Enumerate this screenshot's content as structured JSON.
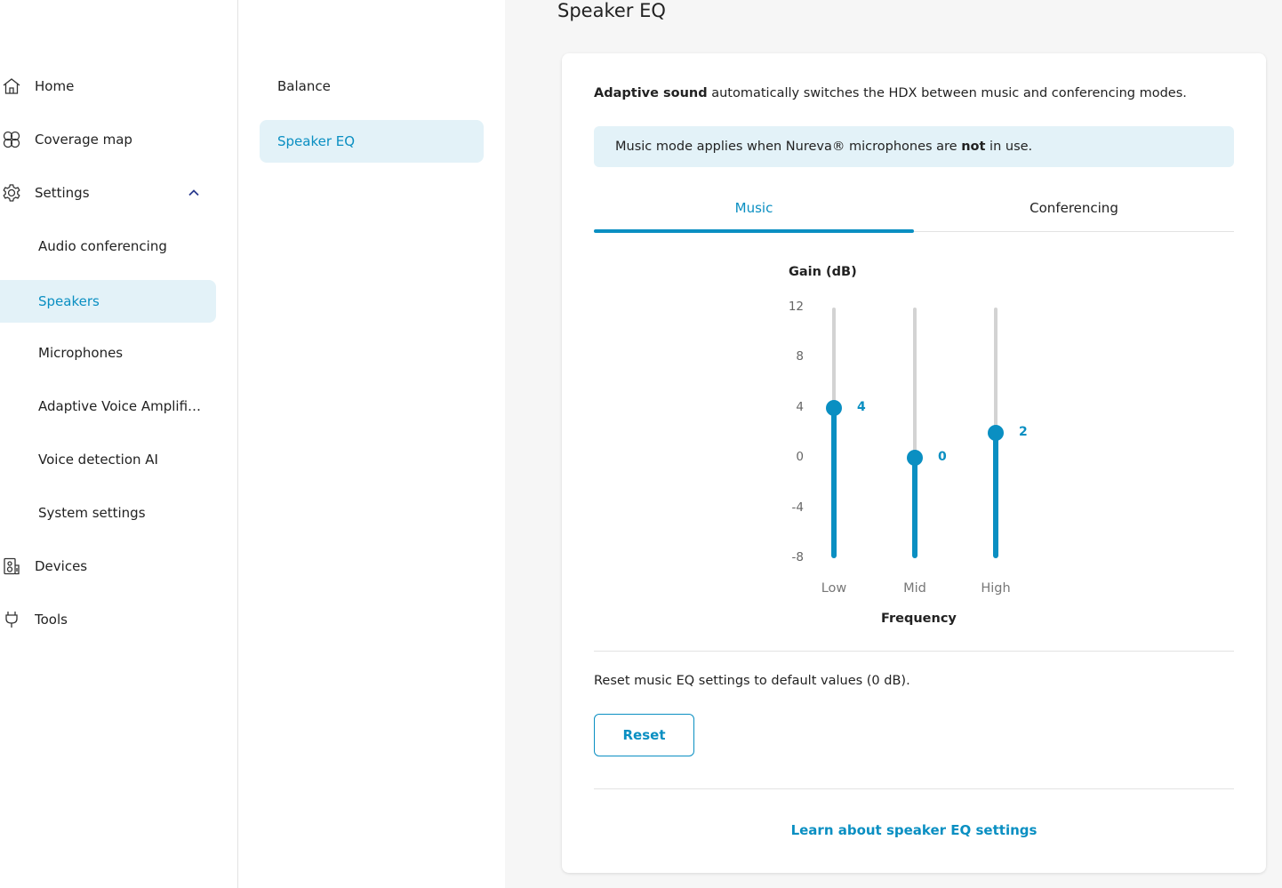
{
  "nav": {
    "home": "Home",
    "coverage_map": "Coverage map",
    "settings": "Settings",
    "sub": {
      "audio_conferencing": "Audio conferencing",
      "speakers": "Speakers",
      "microphones": "Microphones",
      "adaptive_voice": "Adaptive Voice Amplifi…",
      "voice_detection": "Voice detection AI",
      "system_settings": "System settings"
    },
    "devices": "Devices",
    "tools": "Tools",
    "icons": {
      "home": "home-icon",
      "coverage_map": "coverage-map-icon",
      "settings": "gear-icon",
      "settings_chevron": "chevron-up-icon",
      "devices": "devices-icon",
      "tools": "tools-icon"
    }
  },
  "subnav": {
    "balance": "Balance",
    "speaker_eq": "Speaker EQ"
  },
  "page": {
    "title": "Speaker EQ"
  },
  "card": {
    "intro_bold": "Adaptive sound",
    "intro_rest": " automatically switches the HDX between music and conferencing modes.",
    "banner_pre": "Music mode applies when Nureva® microphones are ",
    "banner_bold": "not",
    "banner_post": " in use.",
    "tabs": {
      "music": "Music",
      "conferencing": "Conferencing"
    },
    "eq": {
      "y_title": "Gain (dB)",
      "x_title": "Frequency",
      "ticks": [
        "12",
        "8",
        "4",
        "0",
        "-4",
        "-8"
      ],
      "bands": [
        {
          "name": "Low",
          "value": 4,
          "label": "4"
        },
        {
          "name": "Mid",
          "value": 0,
          "label": "0"
        },
        {
          "name": "High",
          "value": 2,
          "label": "2"
        }
      ],
      "range": [
        -8,
        12
      ]
    },
    "reset_text": "Reset music EQ settings to default values (0 dB).",
    "reset_button": "Reset",
    "learn_link": "Learn about speaker EQ settings"
  },
  "colors": {
    "accent": "#0a8fc2",
    "accent_bg": "#e3f2f8",
    "track": "#d3d3d3"
  }
}
